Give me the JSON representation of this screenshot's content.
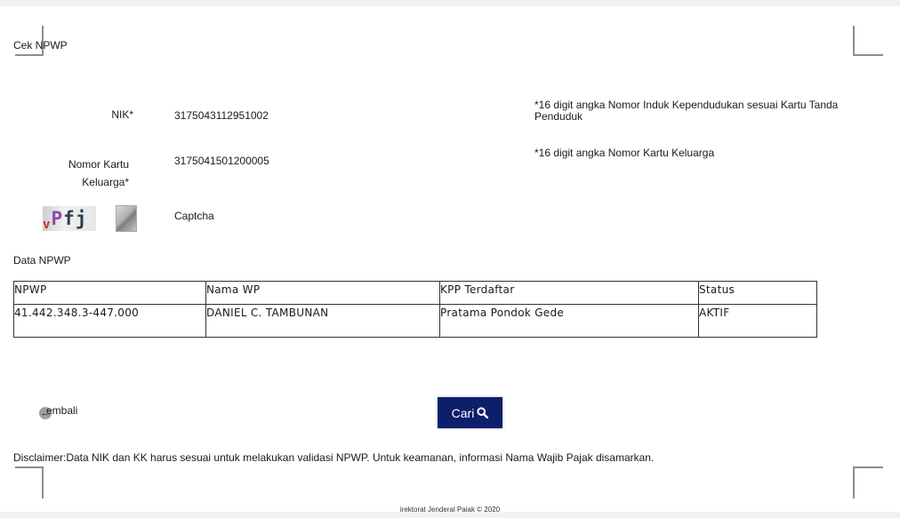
{
  "page_title": "Cek NPWP",
  "form": {
    "nik_label": "NIK*",
    "nik_value": "3175043112951002",
    "nik_hint": "*16 digit angka Nomor Induk Kependudukan sesuai Kartu Tanda Penduduk",
    "kk_label": "Nomor Kartu Keluarga*",
    "kk_value": "3175041501200005",
    "kk_hint": "*16 digit angka Nomor Kartu Keluarga",
    "captcha_text": "vPfj",
    "captcha_label": "Captcha"
  },
  "data_section": {
    "title": "Data NPWP",
    "columns": [
      "NPWP",
      "Nama WP",
      "KPP Terdaftar",
      "Status"
    ],
    "rows": [
      [
        "41.442.348.3-447.000",
        "DANIEL C. TAMBUNAN",
        "Pratama Pondok Gede",
        "AKTIF"
      ]
    ]
  },
  "actions": {
    "back_label": "embali",
    "search_label": "Cari",
    "search_icon": "search-icon",
    "back_icon": "arrow-left-icon"
  },
  "disclaimer": "Disclaimer:Data NIK dan KK harus sesuai untuk melakukan validasi NPWP. Untuk keamanan, informasi Nama Wajib Pajak disamarkan.",
  "footer": "irektorat Jenderal Paiak © 2020",
  "colors": {
    "button_bg": "#0c1f6b",
    "page_bg": "#ffffff"
  }
}
